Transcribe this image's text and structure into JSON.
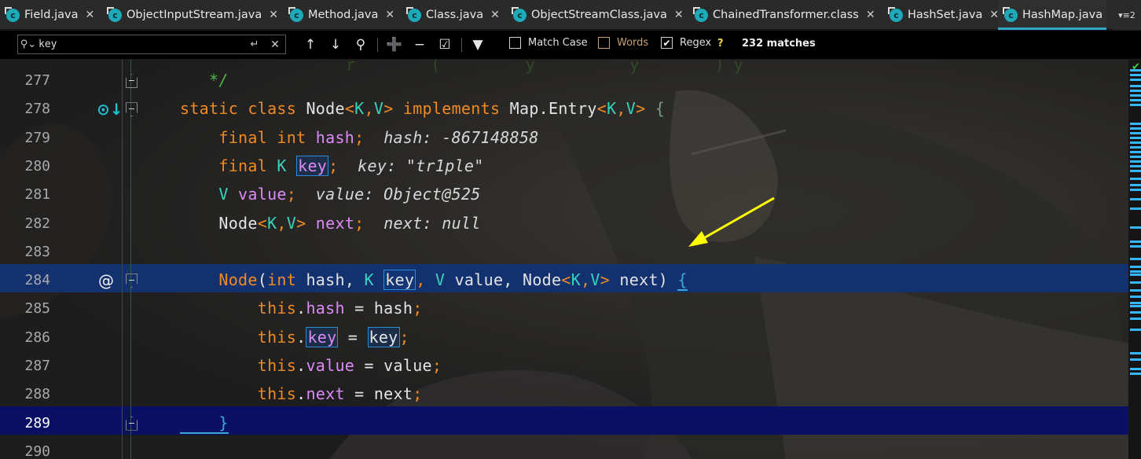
{
  "tabs": [
    {
      "label": "Field.java",
      "active": false
    },
    {
      "label": "ObjectInputStream.java",
      "active": false
    },
    {
      "label": "Method.java",
      "active": false
    },
    {
      "label": "Class.java",
      "active": false
    },
    {
      "label": "ObjectStreamClass.java",
      "active": false
    },
    {
      "label": "ChainedTransformer.class",
      "active": false
    },
    {
      "label": "HashSet.java",
      "active": false
    },
    {
      "label": "HashMap.java",
      "active": true
    }
  ],
  "tab_icon_letter": "c",
  "tab_more_label": "▾≡2",
  "search": {
    "value": "key",
    "match_case_label": "Match Case",
    "words_label": "Words",
    "regex_label": "Regex",
    "regex_help": "?",
    "matches": "232 matches",
    "match_case_checked": false,
    "words_checked": false,
    "regex_checked": true
  },
  "code": {
    "ghost_text": "r        (         y          y        ) y",
    "lines": [
      {
        "num": "277",
        "parts": [
          {
            "t": "   */",
            "c": "cm"
          }
        ]
      },
      {
        "num": "278",
        "parts": [
          {
            "t": "static class ",
            "c": "kw"
          },
          {
            "t": "Node",
            "c": "br"
          },
          {
            "t": "<",
            "c": "kw"
          },
          {
            "t": "K",
            "c": "ty"
          },
          {
            "t": ",",
            "c": "kw"
          },
          {
            "t": "V",
            "c": "ty"
          },
          {
            "t": "> ",
            "c": "kw"
          },
          {
            "t": "implements ",
            "c": "kw"
          },
          {
            "t": "Map.Entry",
            "c": "br"
          },
          {
            "t": "<",
            "c": "kw"
          },
          {
            "t": "K",
            "c": "ty"
          },
          {
            "t": ",",
            "c": "kw"
          },
          {
            "t": "V",
            "c": "ty"
          },
          {
            "t": "> ",
            "c": "kw"
          },
          {
            "t": "{",
            "c": "brace-open"
          }
        ]
      },
      {
        "num": "279",
        "parts": [
          {
            "t": "    final int ",
            "c": "kw"
          },
          {
            "t": "hash",
            "c": "fld"
          },
          {
            "t": ";  ",
            "c": "kw"
          },
          {
            "t": "hash: -867148858",
            "c": "dbg"
          }
        ]
      },
      {
        "num": "280",
        "parts": [
          {
            "t": "    final ",
            "c": "kw"
          },
          {
            "t": "K ",
            "c": "ty"
          },
          {
            "t": "key",
            "c": "fld match"
          },
          {
            "t": ";  ",
            "c": "kw"
          },
          {
            "t": "key: \"tr1ple\"",
            "c": "dbg"
          }
        ]
      },
      {
        "num": "281",
        "parts": [
          {
            "t": "    V ",
            "c": "ty"
          },
          {
            "t": "value",
            "c": "fld"
          },
          {
            "t": ";  ",
            "c": "kw"
          },
          {
            "t": "value: Object@525",
            "c": "dbg"
          }
        ]
      },
      {
        "num": "282",
        "parts": [
          {
            "t": "    Node",
            "c": "br"
          },
          {
            "t": "<",
            "c": "kw"
          },
          {
            "t": "K",
            "c": "ty"
          },
          {
            "t": ",",
            "c": "kw"
          },
          {
            "t": "V",
            "c": "ty"
          },
          {
            "t": "> ",
            "c": "kw"
          },
          {
            "t": "next",
            "c": "fld"
          },
          {
            "t": ";  ",
            "c": "kw"
          },
          {
            "t": "next: null",
            "c": "dbg"
          }
        ]
      },
      {
        "num": "283",
        "parts": []
      },
      {
        "num": "284",
        "parts": [
          {
            "t": "    Node",
            "c": "kw"
          },
          {
            "t": "(",
            "c": "br"
          },
          {
            "t": "int ",
            "c": "kw"
          },
          {
            "t": "hash, ",
            "c": "br"
          },
          {
            "t": "K ",
            "c": "ty"
          },
          {
            "t": "key",
            "c": "br match"
          },
          {
            "t": ", ",
            "c": "kw"
          },
          {
            "t": "V ",
            "c": "ty"
          },
          {
            "t": "value, ",
            "c": "br"
          },
          {
            "t": "Node",
            "c": "br"
          },
          {
            "t": "<",
            "c": "kw"
          },
          {
            "t": "K",
            "c": "ty"
          },
          {
            "t": ",",
            "c": "kw"
          },
          {
            "t": "V",
            "c": "ty"
          },
          {
            "t": "> ",
            "c": "kw"
          },
          {
            "t": "next) ",
            "c": "br"
          },
          {
            "t": "{",
            "c": "brace-match"
          }
        ]
      },
      {
        "num": "285",
        "parts": [
          {
            "t": "        this",
            "c": "kw"
          },
          {
            "t": ".",
            "c": "br"
          },
          {
            "t": "hash",
            "c": "fld"
          },
          {
            "t": " = hash",
            "c": "br"
          },
          {
            "t": ";",
            "c": "kw"
          }
        ]
      },
      {
        "num": "286",
        "parts": [
          {
            "t": "        this",
            "c": "kw"
          },
          {
            "t": ".",
            "c": "br"
          },
          {
            "t": "key",
            "c": "fld match"
          },
          {
            "t": " = ",
            "c": "br"
          },
          {
            "t": "key",
            "c": "br match"
          },
          {
            "t": ";",
            "c": "kw"
          }
        ]
      },
      {
        "num": "287",
        "parts": [
          {
            "t": "        this",
            "c": "kw"
          },
          {
            "t": ".",
            "c": "br"
          },
          {
            "t": "value",
            "c": "fld"
          },
          {
            "t": " = value",
            "c": "br"
          },
          {
            "t": ";",
            "c": "kw"
          }
        ]
      },
      {
        "num": "288",
        "parts": [
          {
            "t": "        this",
            "c": "kw"
          },
          {
            "t": ".",
            "c": "br"
          },
          {
            "t": "next",
            "c": "fld"
          },
          {
            "t": " = next",
            "c": "br"
          },
          {
            "t": ";",
            "c": "kw"
          }
        ]
      },
      {
        "num": "289",
        "parts": [
          {
            "t": "    }",
            "c": "brace-match"
          }
        ]
      },
      {
        "num": "290",
        "parts": []
      }
    ]
  },
  "colors": {
    "keyword": "#f08a24",
    "type": "#39d3bb",
    "field": "#dc8af5",
    "comment": "#4fb64a",
    "selection_band": "#13316f",
    "caret_band": "#0a1064",
    "match_border": "#2a8cd8",
    "arrow": "#ffff00",
    "tab_accent": "#2fa8c6"
  },
  "icons": {
    "search": "search-icon",
    "newline": "newline-icon",
    "clear": "close-icon",
    "prev": "arrow-up-icon",
    "next": "arrow-down-icon",
    "find_all": "find-all-icon",
    "add_selection": "add-selection-icon",
    "remove_selection": "remove-selection-icon",
    "select_all": "select-all-occurrences-icon",
    "filter": "filter-icon",
    "implements_gutter": "implements-gutter-icon",
    "annotation_gutter": "annotation-gutter-icon"
  }
}
